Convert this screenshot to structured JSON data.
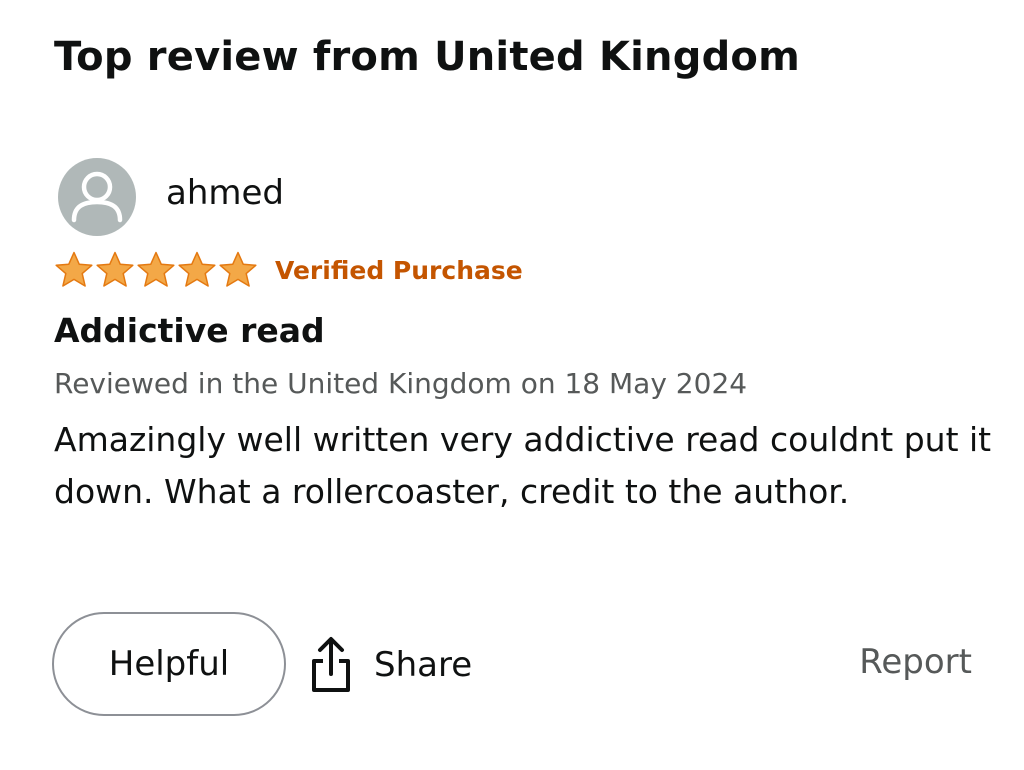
{
  "section": {
    "heading": "Top review from United Kingdom"
  },
  "review": {
    "reviewer": {
      "name": "ahmed",
      "avatar_icon": "user-silhouette-icon"
    },
    "rating": {
      "stars": 5,
      "max_stars": 5,
      "star_color": "#f3a847"
    },
    "verified_label": "Verified Purchase",
    "title": "Addictive read",
    "meta": "Reviewed in the United Kingdom on 18 May 2024",
    "body": "Amazingly well written very addictive read couldnt put it down. What a rollercoaster, credit to the author."
  },
  "actions": {
    "helpful_label": "Helpful",
    "share_label": "Share",
    "share_icon": "share-icon",
    "report_label": "Report"
  },
  "colors": {
    "verified": "#c45500",
    "meta_text": "#565959",
    "avatar_bg": "#b0b8b8"
  }
}
